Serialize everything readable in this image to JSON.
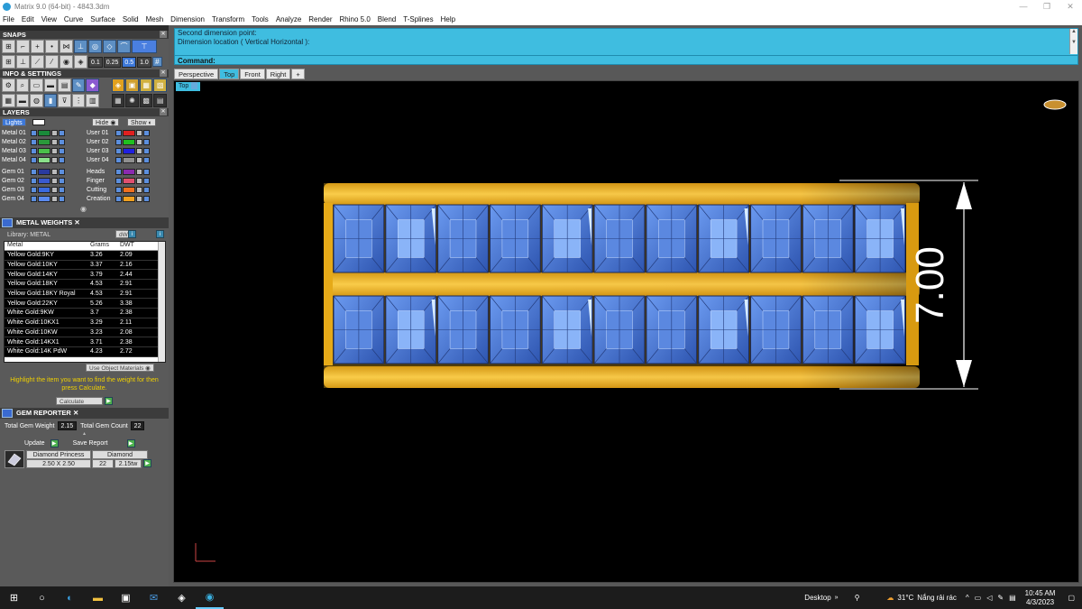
{
  "window": {
    "title": "Matrix 9.0 (64-bit) - 4843.3dm",
    "controls": [
      "—",
      "❐",
      "✕"
    ]
  },
  "menu": [
    "File",
    "Edit",
    "View",
    "Curve",
    "Surface",
    "Solid",
    "Mesh",
    "Dimension",
    "Transform",
    "Tools",
    "Analyze",
    "Render",
    "Rhino 5.0",
    "Blend",
    "T-Splines",
    "Help"
  ],
  "snaps": {
    "title": "SNAPS",
    "values": [
      "0.1",
      "0.25",
      "0.5",
      "1.0"
    ]
  },
  "info": {
    "title": "INFO & SETTINGS"
  },
  "layers": {
    "title": "LAYERS",
    "lights_label": "Lights",
    "hide_label": "Hide",
    "show_label": "Show",
    "left": [
      {
        "name": "Metal 01",
        "color": "#1a8a3a"
      },
      {
        "name": "Metal 02",
        "color": "#2a9a3a"
      },
      {
        "name": "Metal 03",
        "color": "#4ac04a"
      },
      {
        "name": "Metal 04",
        "color": "#8ae08a"
      },
      {
        "name": "Gem 01",
        "color": "#2a3aa0"
      },
      {
        "name": "Gem 02",
        "color": "#3a5ad0"
      },
      {
        "name": "Gem 03",
        "color": "#3a6ae0"
      },
      {
        "name": "Gem 04",
        "color": "#5a8af0"
      }
    ],
    "right": [
      {
        "name": "User 01",
        "color": "#e02020"
      },
      {
        "name": "User 02",
        "color": "#20c020"
      },
      {
        "name": "User 03",
        "color": "#2020e0"
      },
      {
        "name": "User 04",
        "color": "#909090"
      },
      {
        "name": "Heads",
        "color": "#8a2ab0"
      },
      {
        "name": "Finger",
        "color": "#e05070"
      },
      {
        "name": "Cutting",
        "color": "#f07020"
      },
      {
        "name": "Creation",
        "color": "#f0a020"
      }
    ]
  },
  "metal_weights": {
    "title": "METAL WEIGHTS",
    "library_label": "Library:",
    "library_value": "METAL",
    "unit_badge": "dW",
    "columns": [
      "Metal",
      "Grams",
      "DWT"
    ],
    "rows": [
      [
        "Yellow Gold:9KY",
        "3.26",
        "2.09"
      ],
      [
        "Yellow Gold:10KY",
        "3.37",
        "2.16"
      ],
      [
        "Yellow Gold:14KY",
        "3.79",
        "2.44"
      ],
      [
        "Yellow Gold:18KY",
        "4.53",
        "2.91"
      ],
      [
        "Yellow Gold:18KY Royal",
        "4.53",
        "2.91"
      ],
      [
        "Yellow Gold:22KY",
        "5.26",
        "3.38"
      ],
      [
        "White Gold:9KW",
        "3.7",
        "2.38"
      ],
      [
        "White Gold:10KX1",
        "3.29",
        "2.11"
      ],
      [
        "White Gold:10KW",
        "3.23",
        "2.08"
      ],
      [
        "White Gold:14KX1",
        "3.71",
        "2.38"
      ],
      [
        "White Gold:14K PdW",
        "4.23",
        "2.72"
      ]
    ],
    "use_object_materials": "Use Object Materials",
    "hint": "Highlight the item you want to find the weight for then press Calculate.",
    "calculate_label": "Calculate"
  },
  "gem_reporter": {
    "title": "GEM REPORTER",
    "total_weight_label": "Total Gem Weight",
    "total_weight_value": "2.15",
    "total_count_label": "Total Gem Count",
    "total_count_value": "22",
    "update_label": "Update",
    "save_label": "Save Report",
    "gem": {
      "cut": "Diamond Princess",
      "type": "Diamond",
      "size": "2.50 X 2.50",
      "count": "22",
      "weight": "2.15tw"
    }
  },
  "command": {
    "line1": "Second dimension point:",
    "line2": "Dimension location ( Vertical  Horizontal ):",
    "prompt": "Command:"
  },
  "view_tabs": [
    "Perspective",
    "Top",
    "Front",
    "Right",
    "+"
  ],
  "active_view": "Top",
  "viewport": {
    "label": "Top",
    "dimension": "7.00",
    "gems_per_row": 11,
    "rows": 2
  },
  "taskbar": {
    "desktop_label": "Desktop",
    "temperature": "31°C",
    "weather": "Nắng rải rác",
    "time": "10:45 AM",
    "date": "4/3/2023"
  },
  "colors": {
    "panel": "#5a5a5a",
    "command_bg": "#3fbde0",
    "gold": "#f0b820",
    "gem_blue": "#4a7ad8"
  }
}
